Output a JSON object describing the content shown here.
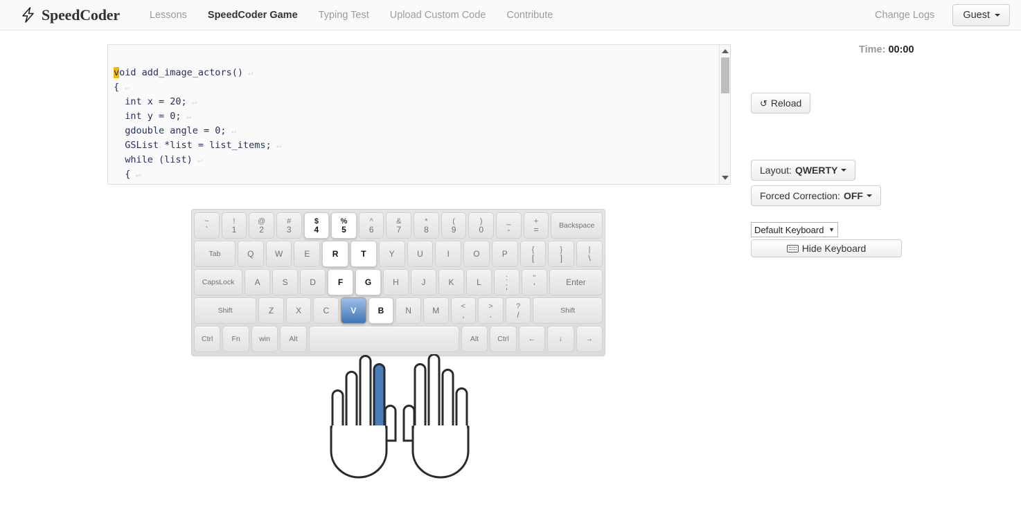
{
  "navbar": {
    "brand": "SpeedCoder",
    "brand_icon": "lightning-bolt-icon",
    "links": [
      {
        "label": "Lessons",
        "active": false
      },
      {
        "label": "SpeedCoder Game",
        "active": true
      },
      {
        "label": "Typing Test",
        "active": false
      },
      {
        "label": "Upload Custom Code",
        "active": false
      },
      {
        "label": "Contribute",
        "active": false
      }
    ],
    "right_link": "Change Logs",
    "user_button": "Guest"
  },
  "editor": {
    "language": "c",
    "cursor_char": "v",
    "lines": [
      {
        "text": "oid add_image_actors()",
        "indent": 0,
        "newline": true,
        "first": true
      },
      {
        "text": "{",
        "indent": 0,
        "newline": true
      },
      {
        "text": "  int x = 20;",
        "indent": 0,
        "newline": true
      },
      {
        "text": "  int y = 0;",
        "indent": 0,
        "newline": true
      },
      {
        "text": "  gdouble angle = 0;",
        "indent": 0,
        "newline": true
      },
      {
        "text": "  GSList *list = list_items;",
        "indent": 0,
        "newline": true
      },
      {
        "text": "  while (list)",
        "indent": 0,
        "newline": true
      },
      {
        "text": "  {",
        "indent": 0,
        "newline": true
      }
    ],
    "newline_glyph": "↵",
    "scrollbar": {
      "up_arrow": "▲",
      "down_arrow": "▼"
    }
  },
  "panel": {
    "time_label": "Time:",
    "time_value": "00:00",
    "reload_label": "Reload",
    "reload_icon": "refresh-icon",
    "layout_label": "Layout:",
    "layout_value": "QWERTY",
    "forced_correction_label": "Forced Correction:",
    "forced_correction_value": "OFF",
    "keyboard_select_value": "Default Keyboard",
    "keyboard_select_caret": "▼",
    "hide_keyboard_label": "Hide Keyboard",
    "hide_keyboard_icon": "keyboard-icon"
  },
  "keyboard": {
    "rows": [
      {
        "name": "number-row",
        "keys": [
          {
            "top": "~",
            "bot": "`",
            "state": "normal",
            "class": ""
          },
          {
            "top": "!",
            "bot": "1",
            "state": "normal",
            "class": ""
          },
          {
            "top": "@",
            "bot": "2",
            "state": "normal",
            "class": ""
          },
          {
            "top": "#",
            "bot": "3",
            "state": "normal",
            "class": ""
          },
          {
            "top": "$",
            "bot": "4",
            "state": "highlight",
            "class": ""
          },
          {
            "top": "%",
            "bot": "5",
            "state": "highlight",
            "class": ""
          },
          {
            "top": "^",
            "bot": "6",
            "state": "normal",
            "class": ""
          },
          {
            "top": "&",
            "bot": "7",
            "state": "normal",
            "class": ""
          },
          {
            "top": "*",
            "bot": "8",
            "state": "normal",
            "class": ""
          },
          {
            "top": "(",
            "bot": "9",
            "state": "normal",
            "class": ""
          },
          {
            "top": ")",
            "bot": "0",
            "state": "normal",
            "class": ""
          },
          {
            "top": "_",
            "bot": "-",
            "state": "normal",
            "class": ""
          },
          {
            "top": "+",
            "bot": "=",
            "state": "normal",
            "class": ""
          },
          {
            "single": "Backspace",
            "state": "normal",
            "class": "wide-bs"
          }
        ]
      },
      {
        "name": "top-letter-row",
        "keys": [
          {
            "single": "Tab",
            "state": "normal",
            "class": "wide-tab"
          },
          {
            "single": "Q",
            "state": "normal",
            "class": ""
          },
          {
            "single": "W",
            "state": "normal",
            "class": ""
          },
          {
            "single": "E",
            "state": "normal",
            "class": ""
          },
          {
            "single": "R",
            "state": "highlight",
            "class": ""
          },
          {
            "single": "T",
            "state": "highlight",
            "class": ""
          },
          {
            "single": "Y",
            "state": "normal",
            "class": ""
          },
          {
            "single": "U",
            "state": "normal",
            "class": ""
          },
          {
            "single": "I",
            "state": "normal",
            "class": ""
          },
          {
            "single": "O",
            "state": "normal",
            "class": ""
          },
          {
            "single": "P",
            "state": "normal",
            "class": ""
          },
          {
            "top": "{",
            "bot": "[",
            "state": "normal",
            "class": ""
          },
          {
            "top": "}",
            "bot": "]",
            "state": "normal",
            "class": ""
          },
          {
            "top": "|",
            "bot": "\\",
            "state": "normal",
            "class": ""
          }
        ]
      },
      {
        "name": "home-row",
        "keys": [
          {
            "single": "CapsLock",
            "state": "normal",
            "class": "wide-caps"
          },
          {
            "single": "A",
            "state": "normal",
            "class": ""
          },
          {
            "single": "S",
            "state": "normal",
            "class": ""
          },
          {
            "single": "D",
            "state": "normal",
            "class": ""
          },
          {
            "single": "F",
            "state": "highlight",
            "class": ""
          },
          {
            "single": "G",
            "state": "highlight",
            "class": ""
          },
          {
            "single": "H",
            "state": "normal",
            "class": ""
          },
          {
            "single": "J",
            "state": "normal",
            "class": ""
          },
          {
            "single": "K",
            "state": "normal",
            "class": ""
          },
          {
            "single": "L",
            "state": "normal",
            "class": ""
          },
          {
            "top": ":",
            "bot": ";",
            "state": "normal",
            "class": ""
          },
          {
            "top": "\"",
            "bot": "'",
            "state": "normal",
            "class": ""
          },
          {
            "single": "Enter",
            "state": "normal",
            "class": "wide-enter"
          }
        ]
      },
      {
        "name": "bottom-letter-row",
        "keys": [
          {
            "single": "Shift",
            "state": "normal",
            "class": "wide-shl"
          },
          {
            "single": "Z",
            "state": "normal",
            "class": ""
          },
          {
            "single": "X",
            "state": "normal",
            "class": ""
          },
          {
            "single": "C",
            "state": "normal",
            "class": ""
          },
          {
            "single": "V",
            "state": "active",
            "class": ""
          },
          {
            "single": "B",
            "state": "highlight",
            "class": ""
          },
          {
            "single": "N",
            "state": "normal",
            "class": ""
          },
          {
            "single": "M",
            "state": "normal",
            "class": ""
          },
          {
            "top": "<",
            "bot": ",",
            "state": "normal",
            "class": ""
          },
          {
            "top": ">",
            "bot": ".",
            "state": "normal",
            "class": ""
          },
          {
            "top": "?",
            "bot": "/",
            "state": "normal",
            "class": ""
          },
          {
            "single": "Shift",
            "state": "normal",
            "class": "wide-shr"
          }
        ]
      },
      {
        "name": "modifier-row",
        "keys": [
          {
            "single": "Ctrl",
            "state": "normal",
            "class": "mod"
          },
          {
            "single": "Fn",
            "state": "normal",
            "class": "mod"
          },
          {
            "single": "win",
            "state": "normal",
            "class": "mod"
          },
          {
            "single": "Alt",
            "state": "normal",
            "class": "mod"
          },
          {
            "single": "",
            "state": "normal",
            "class": "wide-space"
          },
          {
            "single": "Alt",
            "state": "normal",
            "class": "mod"
          },
          {
            "single": "Ctrl",
            "state": "normal",
            "class": "mod"
          },
          {
            "single": "←",
            "state": "normal",
            "class": "mod"
          },
          {
            "single": "↓",
            "state": "normal",
            "class": "mod"
          },
          {
            "single": "→",
            "state": "normal",
            "class": "mod"
          }
        ]
      }
    ]
  },
  "hands": {
    "highlighted_finger": "left-index",
    "highlight_color": "#4a7ebb",
    "outline_color": "#2b2b2b"
  }
}
